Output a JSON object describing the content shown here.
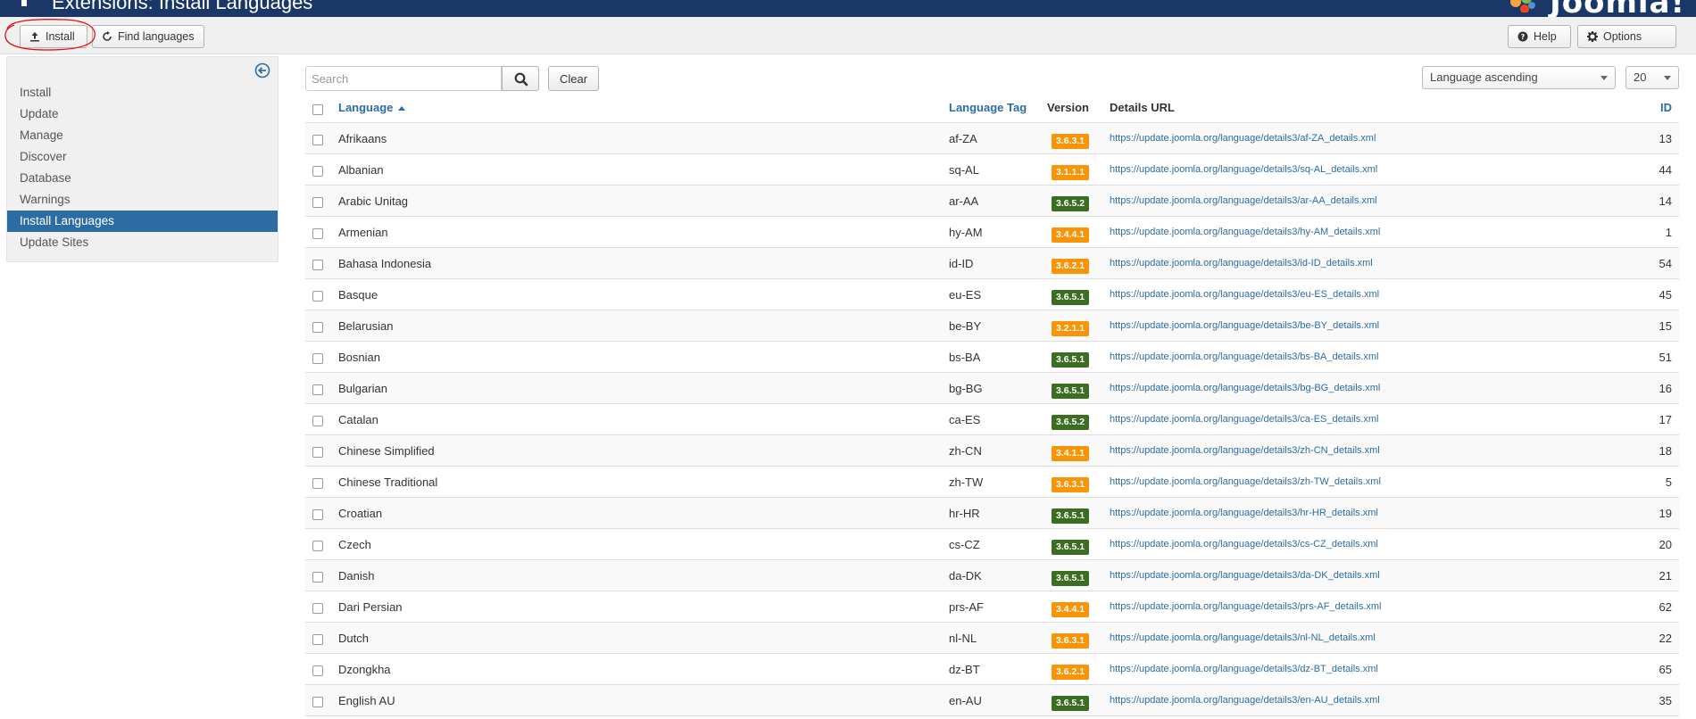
{
  "header": {
    "title": "Extensions: Install Languages",
    "brand": "Joomla!"
  },
  "toolbar": {
    "install_label": "Install",
    "find_label": "Find languages",
    "help_label": "Help",
    "options_label": "Options"
  },
  "sidebar": {
    "items": [
      {
        "label": "Install",
        "active": false
      },
      {
        "label": "Update",
        "active": false
      },
      {
        "label": "Manage",
        "active": false
      },
      {
        "label": "Discover",
        "active": false
      },
      {
        "label": "Database",
        "active": false
      },
      {
        "label": "Warnings",
        "active": false
      },
      {
        "label": "Install Languages",
        "active": true
      },
      {
        "label": "Update Sites",
        "active": false
      }
    ]
  },
  "filters": {
    "search_placeholder": "Search",
    "search_value": "",
    "clear_label": "Clear",
    "sort_value": "Language ascending",
    "limit_value": "20"
  },
  "table": {
    "columns": {
      "language": "Language",
      "tag": "Language Tag",
      "version": "Version",
      "url": "Details URL",
      "id": "ID"
    },
    "rows": [
      {
        "language": "Afrikaans",
        "tag": "af-ZA",
        "version": "3.6.3.1",
        "status": "outdated",
        "url": "https://update.joomla.org/language/details3/af-ZA_details.xml",
        "id": "13"
      },
      {
        "language": "Albanian",
        "tag": "sq-AL",
        "version": "3.1.1.1",
        "status": "outdated",
        "url": "https://update.joomla.org/language/details3/sq-AL_details.xml",
        "id": "44"
      },
      {
        "language": "Arabic Unitag",
        "tag": "ar-AA",
        "version": "3.6.5.2",
        "status": "current",
        "url": "https://update.joomla.org/language/details3/ar-AA_details.xml",
        "id": "14"
      },
      {
        "language": "Armenian",
        "tag": "hy-AM",
        "version": "3.4.4.1",
        "status": "outdated",
        "url": "https://update.joomla.org/language/details3/hy-AM_details.xml",
        "id": "1"
      },
      {
        "language": "Bahasa Indonesia",
        "tag": "id-ID",
        "version": "3.6.2.1",
        "status": "outdated",
        "url": "https://update.joomla.org/language/details3/id-ID_details.xml",
        "id": "54"
      },
      {
        "language": "Basque",
        "tag": "eu-ES",
        "version": "3.6.5.1",
        "status": "current",
        "url": "https://update.joomla.org/language/details3/eu-ES_details.xml",
        "id": "45"
      },
      {
        "language": "Belarusian",
        "tag": "be-BY",
        "version": "3.2.1.1",
        "status": "outdated",
        "url": "https://update.joomla.org/language/details3/be-BY_details.xml",
        "id": "15"
      },
      {
        "language": "Bosnian",
        "tag": "bs-BA",
        "version": "3.6.5.1",
        "status": "current",
        "url": "https://update.joomla.org/language/details3/bs-BA_details.xml",
        "id": "51"
      },
      {
        "language": "Bulgarian",
        "tag": "bg-BG",
        "version": "3.6.5.1",
        "status": "current",
        "url": "https://update.joomla.org/language/details3/bg-BG_details.xml",
        "id": "16"
      },
      {
        "language": "Catalan",
        "tag": "ca-ES",
        "version": "3.6.5.2",
        "status": "current",
        "url": "https://update.joomla.org/language/details3/ca-ES_details.xml",
        "id": "17"
      },
      {
        "language": "Chinese Simplified",
        "tag": "zh-CN",
        "version": "3.4.1.1",
        "status": "outdated",
        "url": "https://update.joomla.org/language/details3/zh-CN_details.xml",
        "id": "18"
      },
      {
        "language": "Chinese Traditional",
        "tag": "zh-TW",
        "version": "3.6.3.1",
        "status": "outdated",
        "url": "https://update.joomla.org/language/details3/zh-TW_details.xml",
        "id": "5"
      },
      {
        "language": "Croatian",
        "tag": "hr-HR",
        "version": "3.6.5.1",
        "status": "current",
        "url": "https://update.joomla.org/language/details3/hr-HR_details.xml",
        "id": "19"
      },
      {
        "language": "Czech",
        "tag": "cs-CZ",
        "version": "3.6.5.1",
        "status": "current",
        "url": "https://update.joomla.org/language/details3/cs-CZ_details.xml",
        "id": "20"
      },
      {
        "language": "Danish",
        "tag": "da-DK",
        "version": "3.6.5.1",
        "status": "current",
        "url": "https://update.joomla.org/language/details3/da-DK_details.xml",
        "id": "21"
      },
      {
        "language": "Dari Persian",
        "tag": "prs-AF",
        "version": "3.4.4.1",
        "status": "outdated",
        "url": "https://update.joomla.org/language/details3/prs-AF_details.xml",
        "id": "62"
      },
      {
        "language": "Dutch",
        "tag": "nl-NL",
        "version": "3.6.3.1",
        "status": "outdated",
        "url": "https://update.joomla.org/language/details3/nl-NL_details.xml",
        "id": "22"
      },
      {
        "language": "Dzongkha",
        "tag": "dz-BT",
        "version": "3.6.2.1",
        "status": "outdated",
        "url": "https://update.joomla.org/language/details3/dz-BT_details.xml",
        "id": "65"
      },
      {
        "language": "English AU",
        "tag": "en-AU",
        "version": "3.6.5.1",
        "status": "current",
        "url": "https://update.joomla.org/language/details3/en-AU_details.xml",
        "id": "35"
      }
    ]
  },
  "colors": {
    "header_bg": "#1a3867",
    "link": "#2d6ca2",
    "badge_current": "#3b6e22",
    "badge_outdated": "#f89406",
    "sidebar_active": "#2d6ca2",
    "annotation": "#e01010"
  },
  "icons": {
    "install": "upload-icon",
    "find": "refresh-icon",
    "help": "question-circle-icon",
    "options": "gear-icon",
    "search": "search-icon",
    "sidebar_toggle": "arrow-left-circle-icon"
  }
}
